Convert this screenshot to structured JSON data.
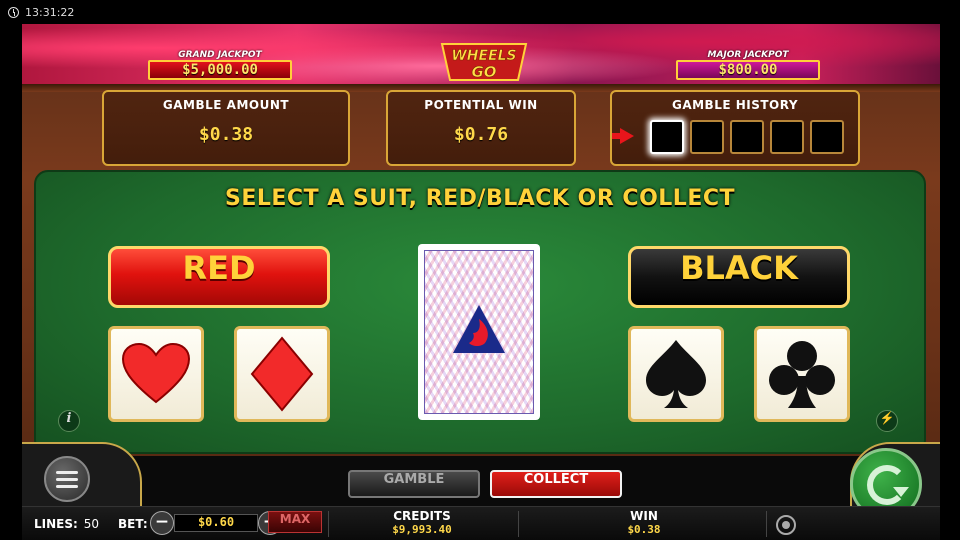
{
  "status": {
    "time": "13:31:22"
  },
  "jackpots": {
    "grand": {
      "label": "GRAND JACKPOT",
      "value": "$5,000.00"
    },
    "major": {
      "label": "MAJOR JACKPOT",
      "value": "$800.00"
    }
  },
  "logo": {
    "text": "WHEELS GO"
  },
  "panels": {
    "gamble_amount": {
      "title": "GAMBLE AMOUNT",
      "value": "$0.38"
    },
    "potential_win": {
      "title": "POTENTIAL WIN",
      "value": "$0.76"
    },
    "gamble_history": {
      "title": "GAMBLE HISTORY",
      "slots": 5
    }
  },
  "table": {
    "instruction": "SELECT A SUIT, RED/BLACK OR COLLECT",
    "red_label": "RED",
    "black_label": "BLACK",
    "suits": [
      "heart",
      "diamond",
      "spade",
      "club"
    ]
  },
  "controls": {
    "gamble_label": "GAMBLE",
    "collect_label": "COLLECT",
    "lines_label": "LINES:",
    "lines_value": "50",
    "bet_label": "BET:",
    "bet_value": "$0.60",
    "max_label": "MAX",
    "credits_label": "CREDITS",
    "credits_value": "$9,993.40",
    "win_label": "WIN",
    "win_value": "$0.38"
  },
  "colors": {
    "table_green": "#1e6a2c",
    "gold": "#ffd23a",
    "red": "#e0120e"
  }
}
